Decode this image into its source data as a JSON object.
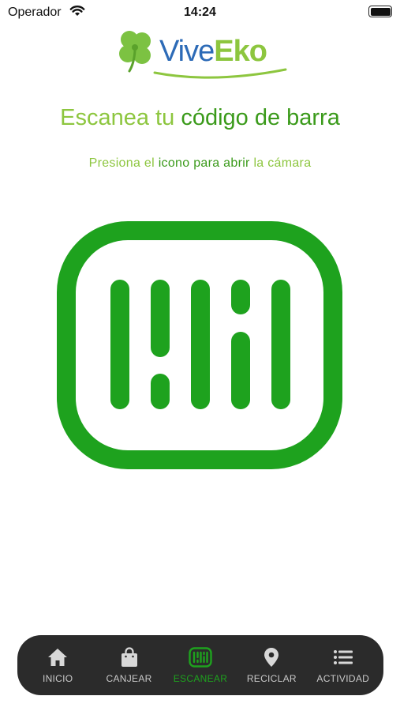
{
  "status_bar": {
    "carrier": "Operador",
    "time": "14:24"
  },
  "logo": {
    "part1": "Vive",
    "part2": "Eko",
    "colors": {
      "vive": "#2d6bb7",
      "eko": "#8dc63f",
      "clover": "#7cc242"
    }
  },
  "header": {
    "title_part1": "Escanea tu",
    "title_part2": "código de barra",
    "subtitle_part1": "Presiona el",
    "subtitle_part2": "icono para abrir",
    "subtitle_part3": "la cámara"
  },
  "scanner": {
    "icon": "barcode-scan-icon",
    "color": "#1ea21e"
  },
  "tabbar": {
    "active_color": "#1ea21e",
    "items": [
      {
        "label": "INICIO",
        "icon": "home-icon"
      },
      {
        "label": "CANJEAR",
        "icon": "shopping-bag-icon"
      },
      {
        "label": "ESCANEAR",
        "icon": "barcode-scan-icon",
        "active": true
      },
      {
        "label": "RECICLAR",
        "icon": "map-pin-icon"
      },
      {
        "label": "ACTIVIDAD",
        "icon": "list-icon"
      }
    ]
  }
}
